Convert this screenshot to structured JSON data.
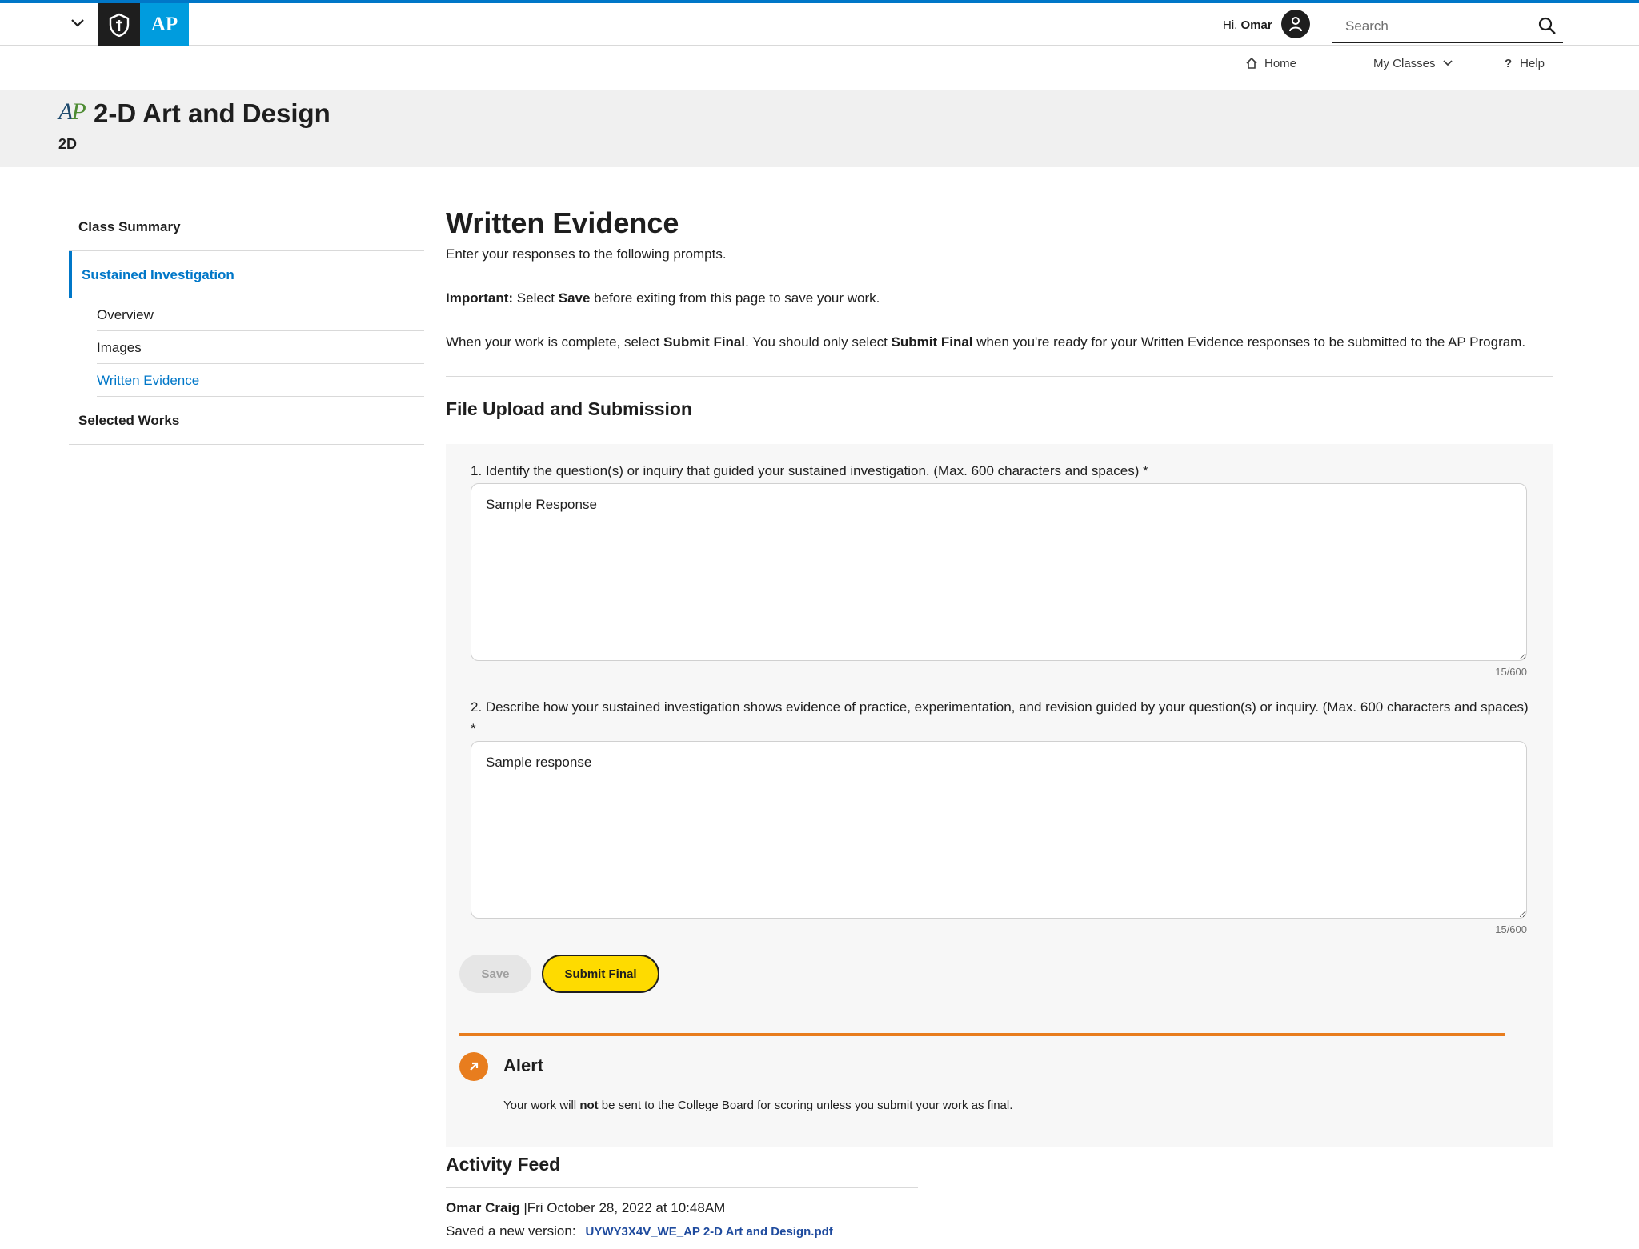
{
  "header": {
    "greeting_prefix": "Hi, ",
    "user_name": "Omar",
    "brand": "AP",
    "search_placeholder": "Search",
    "nav": {
      "home": "Home",
      "my_classes": "My Classes",
      "help": "Help"
    },
    "icons": [
      "chevron-down-icon",
      "college-board-logo",
      "user-icon",
      "search-icon",
      "home-icon",
      "help-icon"
    ]
  },
  "course": {
    "logo_text": "AP",
    "title": "2-D Art and Design",
    "code": "2D"
  },
  "sidebar": {
    "class_summary": "Class Summary",
    "sustained_investigation": "Sustained Investigation",
    "sub_items": [
      "Overview",
      "Images",
      "Written Evidence"
    ],
    "selected_works": "Selected Works"
  },
  "main": {
    "title": "Written Evidence",
    "intro": "Enter your responses to the following prompts.",
    "important_label": "Important:",
    "important_pre": " Select ",
    "important_save": "Save",
    "important_post": " before exiting from this page to save your work.",
    "complete_pre": "When your work is complete, select ",
    "complete_submit1": "Submit Final",
    "complete_mid": ". You should only select ",
    "complete_submit2": "Submit Final",
    "complete_post": " when you're ready for your Written Evidence responses to be submitted to the AP Program.",
    "section_title": "File Upload and Submission"
  },
  "questions": [
    {
      "label": "1. Identify the question(s) or inquiry that guided your sustained investigation. (Max. 600 characters and spaces) *",
      "value": "Sample Response",
      "counter": "15/600"
    },
    {
      "label": "2. Describe how your sustained investigation shows evidence of practice, experimentation, and revision guided by your question(s) or inquiry. (Max. 600 characters and spaces) *",
      "value": "Sample response",
      "counter": "15/600"
    }
  ],
  "buttons": {
    "save": "Save",
    "submit_final": "Submit Final"
  },
  "alert": {
    "title": "Alert",
    "msg_pre": "Your work will ",
    "msg_bold": "not",
    "msg_post": " be sent to the College Board for scoring unless you submit your work as final."
  },
  "activity": {
    "title": "Activity Feed",
    "user": "Omar Craig",
    "separator": " |",
    "timestamp": "Fri October 28, 2022 at 10:48AM",
    "action": "Saved a new version:",
    "file": "UYWY3X4V_WE_AP 2-D Art and Design.pdf"
  },
  "colors": {
    "accent_blue": "#0077c8",
    "ap_blue": "#009cde",
    "submit_yellow": "#fedb00",
    "alert_orange": "#e87d1e"
  }
}
